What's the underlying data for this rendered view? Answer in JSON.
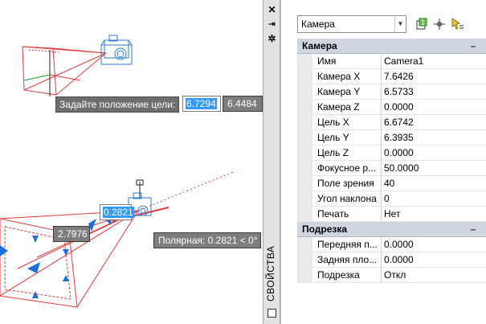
{
  "canvas": {
    "prompt_top": {
      "label": "Задайте положение цели:",
      "input_x": "6.7294",
      "input_y": "6.4484"
    },
    "prompt_bottom": {
      "dynamic_input": "0.2821",
      "distance_box": "2.7976",
      "polar_tooltip": "Полярная: 0.2821 < 0°"
    },
    "colors": {
      "frustum": "#e23a3a",
      "camera_glyph": "#2e7bd6",
      "grip": "#1b6fd8",
      "axis_green": "#1d9e28"
    }
  },
  "palette": {
    "title": "СВОЙСТВА",
    "titlebar_buttons": [
      "close-icon",
      "autohide-icon",
      "settings-icon"
    ],
    "selection": "Камера",
    "toolbar_icons": [
      "toggle-pickadd-icon",
      "select-objects-icon",
      "quick-select-icon"
    ],
    "groups": [
      {
        "name": "Камера",
        "collapse": "–",
        "rows": [
          {
            "name": "Имя",
            "value": "Camera1"
          },
          {
            "name": "Камера X",
            "value": "7.6426"
          },
          {
            "name": "Камера Y",
            "value": "6.5733"
          },
          {
            "name": "Камера Z",
            "value": "0.0000"
          },
          {
            "name": "Цель X",
            "value": "6.6742"
          },
          {
            "name": "Цель Y",
            "value": "6.3935"
          },
          {
            "name": "Цель Z",
            "value": "0.0000"
          },
          {
            "name": "Фокусное р...",
            "value": "50.0000"
          },
          {
            "name": "Поле зрения",
            "value": "40"
          },
          {
            "name": "Угол наклона",
            "value": "0"
          },
          {
            "name": "Печать",
            "value": "Нет"
          }
        ]
      },
      {
        "name": "Подрезка",
        "collapse": "–",
        "rows": [
          {
            "name": "Передняя п...",
            "value": "0.0000"
          },
          {
            "name": "Задняя пло...",
            "value": "0.0000"
          },
          {
            "name": "Подрезка",
            "value": "Откл"
          }
        ]
      }
    ]
  }
}
